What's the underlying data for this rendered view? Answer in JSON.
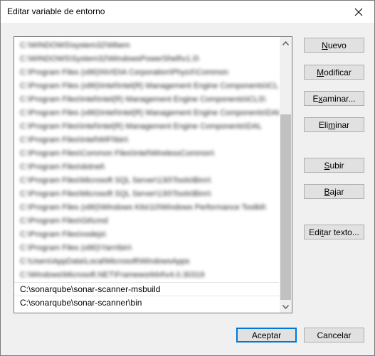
{
  "window": {
    "title": "Editar variable de entorno",
    "close_icon": "close-icon"
  },
  "list": {
    "blurred_entries": [
      "C:\\WINDOWS\\system32\\Wbem",
      "C:\\WINDOWS\\System32\\WindowsPowerShell\\v1.0\\",
      "C:\\Program Files (x86)\\NVIDIA Corporation\\PhysX\\Common",
      "C:\\Program Files (x86)\\Intel\\Intel(R) Management Engine Components\\iCLS\\",
      "C:\\Program Files\\Intel\\Intel(R) Management Engine Components\\iCLS\\",
      "C:\\Program Files (x86)\\Intel\\Intel(R) Management Engine Components\\DAL",
      "C:\\Program Files\\Intel\\Intel(R) Management Engine Components\\DAL",
      "C:\\Program Files\\Intel\\WiFi\\bin\\",
      "C:\\Program Files\\Common Files\\Intel\\WirelessCommon\\",
      "C:\\Program Files\\dotnet\\",
      "C:\\Program Files\\Microsoft SQL Server\\130\\Tools\\Binn\\",
      "C:\\Program Files\\Microsoft SQL Server\\130\\Tools\\Binn\\",
      "C:\\Program Files (x86)\\Windows Kits\\10\\Windows Performance Toolkit\\",
      "C:\\Program Files\\Git\\cmd",
      "C:\\Program Files\\nodejs\\",
      "C:\\Program Files (x86)\\Yarn\\bin\\",
      "C:\\Users\\AppData\\Local\\Microsoft\\WindowsApps",
      "C:\\Windows\\Microsoft.NET\\Framework64\\v4.0.30319"
    ],
    "entries": [
      "C:\\sonarqube\\sonar-scanner-msbuild",
      "C:\\sonarqube\\sonar-scanner\\bin"
    ],
    "scroll_up_icon": "chevron-up-icon",
    "scroll_down_icon": "chevron-down-icon"
  },
  "buttons": {
    "new": {
      "mnemonic": "N",
      "rest": "uevo"
    },
    "edit": {
      "mnemonic": "M",
      "rest": "odificar"
    },
    "browse": {
      "before": "E",
      "mnemonic": "x",
      "rest": "aminar..."
    },
    "delete": {
      "before": "Eli",
      "mnemonic": "m",
      "rest": "inar"
    },
    "up": {
      "mnemonic": "S",
      "rest": "ubir"
    },
    "down": {
      "mnemonic": "B",
      "rest": "ajar"
    },
    "edit_text": {
      "before": "Edi",
      "mnemonic": "t",
      "rest": "ar texto..."
    },
    "accept": "Aceptar",
    "cancel": "Cancelar"
  }
}
